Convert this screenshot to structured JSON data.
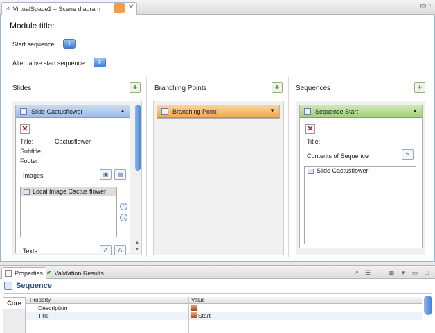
{
  "editor_tab": {
    "title": "VirtualSpace1 – Scene diagram",
    "close": "✕"
  },
  "window_controls": "▭ ▫",
  "module": {
    "title": "Module title:"
  },
  "start_sequence": {
    "label": "Start sequence:"
  },
  "alt_start_sequence": {
    "label": "Alternative start sequence:"
  },
  "slides": {
    "header": "Slides",
    "card": {
      "title": "Slide Cactusflower",
      "title_label": "Title:",
      "title_value": "Cactusflower",
      "subtitle_label": "Subtitle:",
      "footer_label": "Footer:",
      "images_label": "Images",
      "images": [
        "Local Image Cactus flower"
      ],
      "texts_label": "Texts"
    }
  },
  "branching": {
    "header": "Branching Points",
    "card": {
      "title": "Branching Point"
    }
  },
  "sequences": {
    "header": "Sequences",
    "card": {
      "title": "Sequence Start",
      "title_label": "Title:",
      "contents_label": "Contents of Sequence",
      "items": [
        "Slide Cactusflower"
      ]
    }
  },
  "properties_view": {
    "tabs": [
      "Properties",
      "Validation Results"
    ],
    "selection_title": "Sequence",
    "side_tab": "Core",
    "columns": [
      "Property",
      "Value"
    ],
    "rows": [
      {
        "property": "Description",
        "value": ""
      },
      {
        "property": "Title",
        "value": "Start"
      }
    ]
  },
  "colors": {
    "accent_blue": "#3d7fd9",
    "branch_orange": "#f0a850",
    "sequence_green": "#a3cf7b"
  }
}
